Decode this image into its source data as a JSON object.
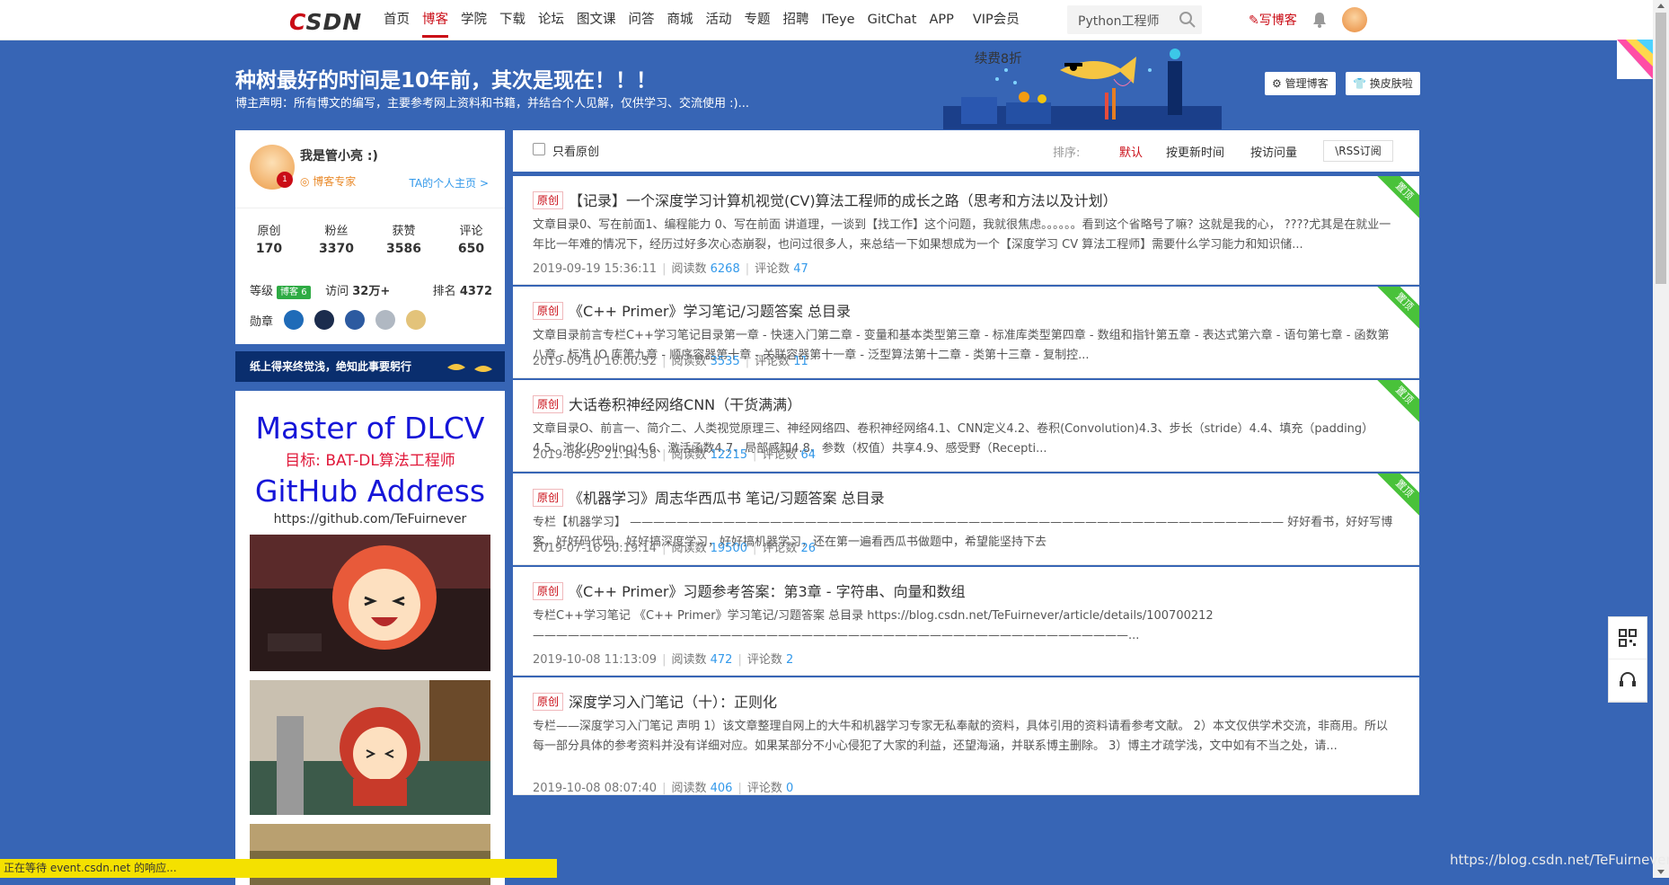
{
  "nav": {
    "logo": "CSDN",
    "links": [
      "首页",
      "博客",
      "学院",
      "下载",
      "论坛",
      "图文课",
      "问答",
      "商城",
      "活动",
      "专题",
      "招聘",
      "ITeye",
      "GitChat",
      "APP"
    ],
    "active_index": 1,
    "vip_label": "VIP会员",
    "vip_badge": "续费8折",
    "search_text": "Python工程师",
    "write_label": "写博客"
  },
  "banner": {
    "title": "种树最好的时间是10年前，其次是现在！！！",
    "subtitle": "博主声明：所有博文的编写，主要参考网上资料和书籍，并结合个人见解，仅供学习、交流使用 :)...",
    "manage_label": "管理博客",
    "skin_label": "换皮肤啦"
  },
  "profile": {
    "name": "我是管小亮 :)",
    "expert": "博客专家",
    "home_link": "TA的个人主页 >",
    "level_badge": "1",
    "stats": [
      {
        "label": "原创",
        "value": "170"
      },
      {
        "label": "粉丝",
        "value": "3370"
      },
      {
        "label": "获赞",
        "value": "3586"
      },
      {
        "label": "评论",
        "value": "650"
      }
    ],
    "level_label": "等级",
    "level_value": "博客 6",
    "visits_label": "访问",
    "visits_value": "32万+",
    "rank_label": "排名",
    "rank_value": "4372",
    "medals_label": "勋章"
  },
  "motto": "纸上得来终觉浅，绝知此事要躬行",
  "ad": {
    "line1": "Master of DLCV",
    "line2": "目标: BAT-DL算法工程师",
    "line3": "GitHub Address",
    "line4": "https://github.com/TeFuirnever"
  },
  "filter": {
    "original_only": "只看原创",
    "sort_label": "排序:",
    "sort_default": "默认",
    "sort_updated": "按更新时间",
    "sort_views": "按访问量",
    "rss": "RSS订阅"
  },
  "articles": [
    {
      "tag": "原创",
      "title": "【记录】一个深度学习计算机视觉(CV)算法工程师的成长之路（思考和方法以及计划）",
      "desc": "文章目录0、写在前面1、编程能力 0、写在前面 讲道理，一谈到【找工作】这个问题，我就很焦虑。。。。。。看到这个省略号了嘛？这就是我的心， ????尤其是在就业一年比一年难的情况下，经历过好多次心态崩裂，也问过很多人，来总结一下如果想成为一个【深度学习 CV 算法工程师】需要什么学习能力和知识储...",
      "date": "2019-09-19 15:36:11",
      "views_label": "阅读数",
      "views": "6268",
      "comments_label": "评论数",
      "comments": "47",
      "pinned": "置顶"
    },
    {
      "tag": "原创",
      "title": "《C++ Primer》学习笔记/习题答案 总目录",
      "desc": "文章目录前言专栏C++学习笔记目录第一章 - 快速入门第二章 - 变量和基本类型第三章 - 标准库类型第四章 - 数组和指针第五章 - 表达式第六章 - 语句第七章 - 函数第八章 - 标准 IO 库第九章 - 顺序容器第十章 - 关联容器第十一章 - 泛型算法第十二章 - 类第十三章 - 复制控...",
      "date": "2019-09-10 16:00:32",
      "views_label": "阅读数",
      "views": "3535",
      "comments_label": "评论数",
      "comments": "11",
      "pinned": "置顶"
    },
    {
      "tag": "原创",
      "title": "大话卷积神经网络CNN（干货满满）",
      "desc": "文章目录O、前言一、简介二、人类视觉原理三、神经网络四、卷积神经网络4.1、CNN定义4.2、卷积(Convolution)4.3、步长（stride）4.4、填充（padding）4.5、池化(Pooling)4.6、激活函数4.7、局部感知4.8、参数（权值）共享4.9、感受野（Recepti...",
      "date": "2019-08-25 21:14:58",
      "views_label": "阅读数",
      "views": "12215",
      "comments_label": "评论数",
      "comments": "64",
      "pinned": "置顶"
    },
    {
      "tag": "原创",
      "title": "《机器学习》周志华西瓜书 笔记/习题答案 总目录",
      "desc": "专栏【机器学习】 ———————————————————————————————————————————————————————— 好好看书，好好写博客，好好码代码，好好搞深度学习，好好搞机器学习，还在第一遍看西瓜书做题中，希望能坚持下去",
      "date": "2019-07-16 20:19:14",
      "views_label": "阅读数",
      "views": "19500",
      "comments_label": "评论数",
      "comments": "26",
      "pinned": "置顶"
    },
    {
      "tag": "原创",
      "title": "《C++ Primer》习题参考答案：第3章 - 字符串、向量和数组",
      "desc": "专栏C++学习笔记 《C++ Primer》学习笔记/习题答案 总目录 https://blog.csdn.net/TeFuirnever/article/details/100700212 ———————————————————————————————————————————————————...",
      "date": "2019-10-08 11:13:09",
      "views_label": "阅读数",
      "views": "472",
      "comments_label": "评论数",
      "comments": "2",
      "pinned": ""
    },
    {
      "tag": "原创",
      "title": "深度学习入门笔记（十）：正则化",
      "desc": "专栏——深度学习入门笔记 声明 1）该文章整理自网上的大牛和机器学习专家无私奉献的资料，具体引用的资料请看参考文献。 2）本文仅供学术交流，非商用。所以每一部分具体的参考资料并没有详细对应。如果某部分不小心侵犯了大家的利益，还望海涵，并联系博主删除。 3）博主才疏学浅，文中如有不当之处，请...",
      "date": "2019-10-08 08:07:40",
      "views_label": "阅读数",
      "views": "406",
      "comments_label": "评论数",
      "comments": "0",
      "pinned": ""
    }
  ],
  "status_bar": "正在等待 event.csdn.net 的响应...",
  "watermark": "https://blog.csdn.net/TeFuirnever",
  "colors": {
    "page_bg": "#3765b5",
    "brand_red": "#ca0c16",
    "link_blue": "#3399ea",
    "pinned_green": "#49c23a",
    "motto_bg": "#0a2e6e"
  }
}
